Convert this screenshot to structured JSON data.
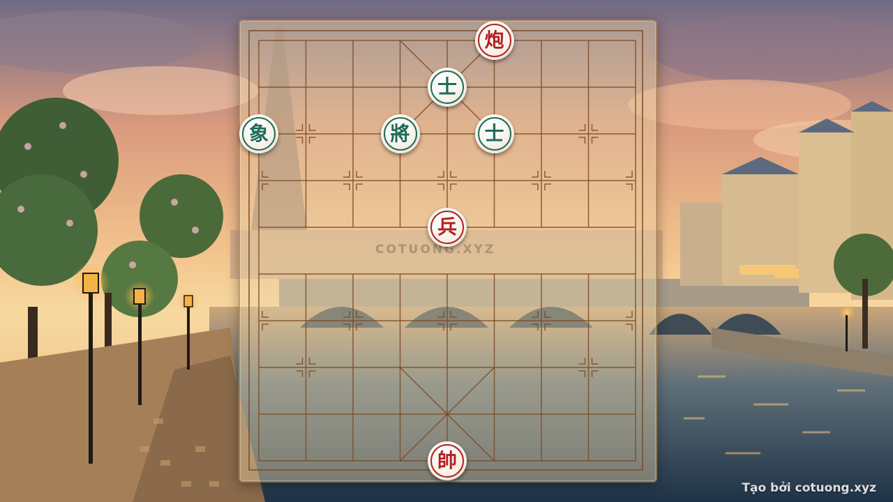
{
  "board": {
    "files": 9,
    "ranks": 10,
    "watermark": "COTUONG.XYZ"
  },
  "pieces": [
    {
      "glyph": "炮",
      "side": "red",
      "file": 5,
      "rank": 0,
      "name": "red-cannon-piece"
    },
    {
      "glyph": "士",
      "side": "black",
      "file": 4,
      "rank": 1,
      "name": "black-advisor-piece"
    },
    {
      "glyph": "象",
      "side": "black",
      "file": 0,
      "rank": 2,
      "name": "black-elephant-piece"
    },
    {
      "glyph": "將",
      "side": "black",
      "file": 3,
      "rank": 2,
      "name": "black-general-piece"
    },
    {
      "glyph": "士",
      "side": "black",
      "file": 5,
      "rank": 2,
      "name": "black-advisor-piece"
    },
    {
      "glyph": "兵",
      "side": "red",
      "file": 4,
      "rank": 4,
      "name": "red-soldier-piece"
    },
    {
      "glyph": "帥",
      "side": "red",
      "file": 4,
      "rank": 9,
      "name": "red-general-piece"
    }
  ],
  "credit": "Tạo bởi cotuong.xyz",
  "colors": {
    "red_piece": "#b52020",
    "black_piece": "#1f6b58",
    "board_line": "#7a4a26"
  }
}
